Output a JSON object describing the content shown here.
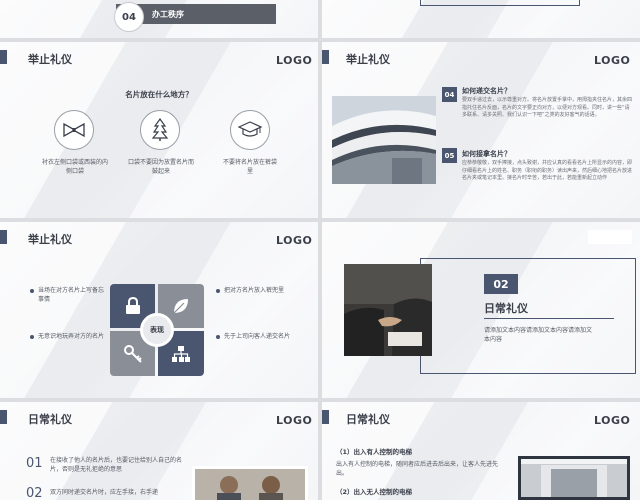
{
  "slide_top_left": {
    "num": "04",
    "title": "办工秩序"
  },
  "slide2": {
    "title": "举止礼仪",
    "logo": "LOGO",
    "question": "名片放在什么地方？",
    "items": [
      {
        "icon": "bowtie-icon",
        "text": "衬衣左侧口袋或西装的内侧口袋"
      },
      {
        "icon": "tree-icon",
        "text": "口袋不要因为放置名片而鼓起来"
      },
      {
        "icon": "graduation-cap-icon",
        "text": "不要将名片放在裤袋里"
      }
    ]
  },
  "slide3": {
    "title": "举止礼仪",
    "logo": "LOGO",
    "sections": [
      {
        "num": "04",
        "heading": "如何递交名片？",
        "body": "要双手递过去，以示尊重对方。将名片放置手掌中，用拇指夹住名片，其余四指托住名片反面，名片的文字要正向对方，以便对方观看。同时，讲一些“请多联系、请多关照、我们认识一下吧”之类的友好客气的话语。"
      },
      {
        "num": "05",
        "heading": "如何接拿名片？",
        "body": "应恭恭敬敬，双手捧接，点头致谢，并应认真的看看名片上所显示的内容，即仔细看名片上的姓名、职务（职衔的职务）读出声来，然后细心地把名片放进名片夹或笔记本里。接名片时辛苦，若出于此，若能重新起立动作"
      }
    ]
  },
  "slide4": {
    "title": "举止礼仪",
    "logo": "LOGO",
    "center": "表现",
    "left_items": [
      "当场在对方名片上写备忘事情",
      "无意识地玩弄对方的名片"
    ],
    "right_items": [
      "把对方名片放入裤兜里",
      "先于上司向客人递交名片"
    ],
    "tile_icons": [
      "lock-icon",
      "leaf-icon",
      "key-icon",
      "org-chart-icon"
    ]
  },
  "slide5": {
    "num": "02",
    "title": "日常礼仪",
    "body": "请添加文本内容请添加文本内容请添加文本内容"
  },
  "slide6": {
    "title": "日常礼仪",
    "logo": "LOGO",
    "items": [
      {
        "num": "01",
        "text": "在接收了他人的名片后，也要记住给别人自己的名片，否则是无礼拒绝的意思"
      },
      {
        "num": "02",
        "text": "双方同时递交名片时，应左手接，右手递"
      }
    ]
  },
  "slide7": {
    "title": "日常礼仪",
    "logo": "LOGO",
    "items": [
      {
        "heading": "（1）出入有人控制的电梯",
        "text": "出入有人控制的电梯，随同者应后进去后出来，让客人先进先出。"
      },
      {
        "heading": "（2）出入无人控制的电梯"
      }
    ]
  }
}
